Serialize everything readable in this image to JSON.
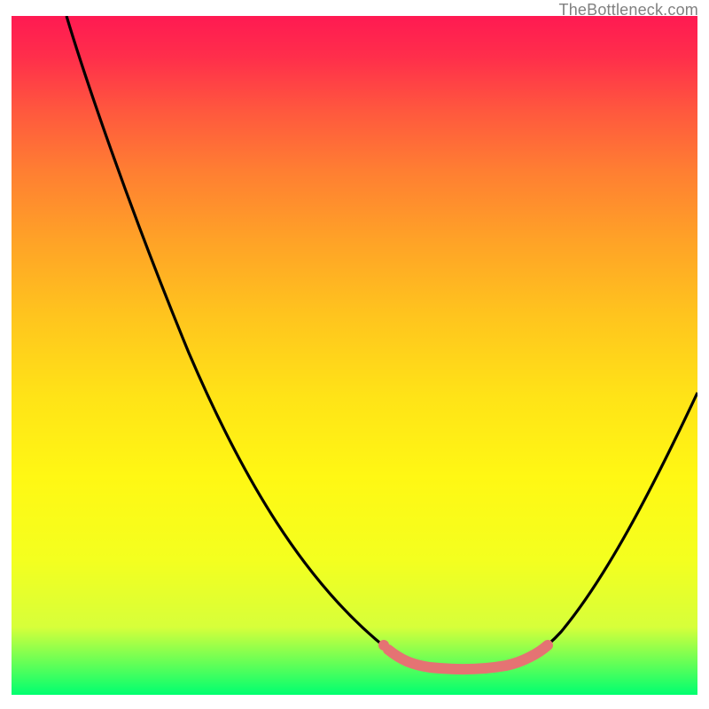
{
  "watermark": "TheBottleneck.com",
  "chart_data": {
    "type": "line",
    "title": "",
    "xlabel": "",
    "ylabel": "",
    "xlim": [
      0,
      100
    ],
    "ylim": [
      0,
      100
    ],
    "series": [
      {
        "name": "curve",
        "color": "#000000",
        "x": [
          8,
          15,
          25,
          35,
          45,
          55,
          62,
          66,
          70,
          74,
          78,
          85,
          92,
          100
        ],
        "y": [
          100,
          88,
          68,
          48,
          30,
          15,
          6,
          4,
          3.5,
          4,
          7,
          18,
          32,
          45
        ]
      },
      {
        "name": "highlight",
        "color": "#e57373",
        "x": [
          55,
          60,
          65,
          70,
          75,
          78
        ],
        "y": [
          7,
          5,
          4,
          3.5,
          5,
          7
        ]
      }
    ],
    "background_gradient": {
      "top": "#ff1a52",
      "bottom": "#00ff70"
    }
  }
}
